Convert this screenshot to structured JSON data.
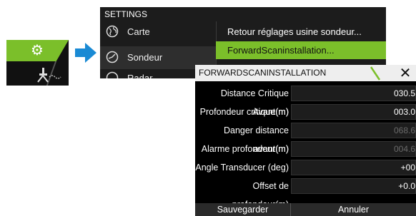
{
  "tile": {
    "icons": [
      "gear-icon",
      "sonar-icon"
    ]
  },
  "arrow": {
    "icon": "arrow-right-icon",
    "color": "#1a8ad4"
  },
  "settings": {
    "title": "SETTINGS",
    "items": [
      {
        "label": "Carte",
        "icon": "globe-icon"
      },
      {
        "label": "Sondeur",
        "icon": "sonar-gauge-icon"
      },
      {
        "label": "Radar",
        "icon": "radar-icon"
      }
    ],
    "submenu": [
      {
        "label": "Retour réglages usine sondeur..."
      },
      {
        "label": "ForwardScaninstallation..."
      }
    ]
  },
  "dialog": {
    "title": "FORWARDSCANINSTALLATION",
    "close_icon": "close-icon",
    "rows": [
      {
        "label": "Distance Critique Avant(m)",
        "value": "030.5",
        "dim": false
      },
      {
        "label": "Profondeur critique(m)",
        "value": "003.0",
        "dim": false
      },
      {
        "label": "Danger distance avant(m)",
        "value": "068.6",
        "dim": true
      },
      {
        "label": "Alarme profondeur(m)",
        "value": "004.6",
        "dim": true
      },
      {
        "label": "Angle Transducer (deg)",
        "value": "+00",
        "dim": false
      },
      {
        "label": "Offset de profondeur(m)",
        "value": "+0.0",
        "dim": false
      }
    ],
    "save_label": "Sauvegarder",
    "cancel_label": "Annuler"
  },
  "colors": {
    "accent": "#7bbf2a",
    "panel": "#1c1c1c",
    "dialog_bg": "#000000",
    "header": "#eeeeee"
  }
}
